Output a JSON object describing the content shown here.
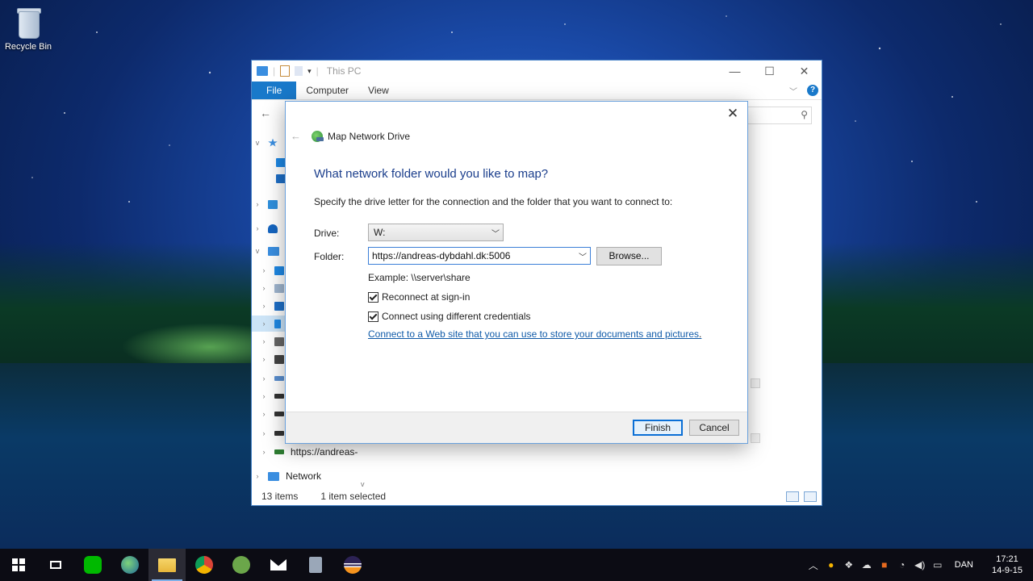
{
  "desktop": {
    "recycle_bin_label": "Recycle Bin"
  },
  "explorer": {
    "title": "This PC",
    "ribbon_tabs": [
      "File",
      "Computer",
      "View"
    ],
    "nav_visible_labels": {
      "mapped_drive": "https://andreas-",
      "network": "Network"
    },
    "status": {
      "items": "13 items",
      "selected": "1 item selected"
    }
  },
  "dialog": {
    "title": "Map Network Drive",
    "heading": "What network folder would you like to map?",
    "instruction": "Specify the drive letter for the connection and the folder that you want to connect to:",
    "drive_label": "Drive:",
    "drive_value": "W:",
    "folder_label": "Folder:",
    "folder_value": "https://andreas-dybdahl.dk:5006",
    "browse_label": "Browse...",
    "example_text": "Example: \\\\server\\share",
    "reconnect_label": "Reconnect at sign-in",
    "reconnect_checked": true,
    "credentials_label": "Connect using different credentials",
    "credentials_checked": true,
    "web_link": "Connect to a Web site that you can use to store your documents and pictures",
    "web_link_tail": ".",
    "finish_label": "Finish",
    "cancel_label": "Cancel"
  },
  "taskbar": {
    "apps": [
      "start-icon",
      "task-view-icon",
      "line-icon",
      "earth-icon",
      "file-explorer-icon",
      "chrome-icon",
      "android-icon",
      "mail-icon",
      "app-icon",
      "eclipse-icon"
    ],
    "language": "DAN",
    "time": "17:21",
    "date": "14-9-15"
  },
  "colors": {
    "accent": "#1979ca",
    "heading": "#1b3e8c",
    "link": "#0f5aa8"
  }
}
